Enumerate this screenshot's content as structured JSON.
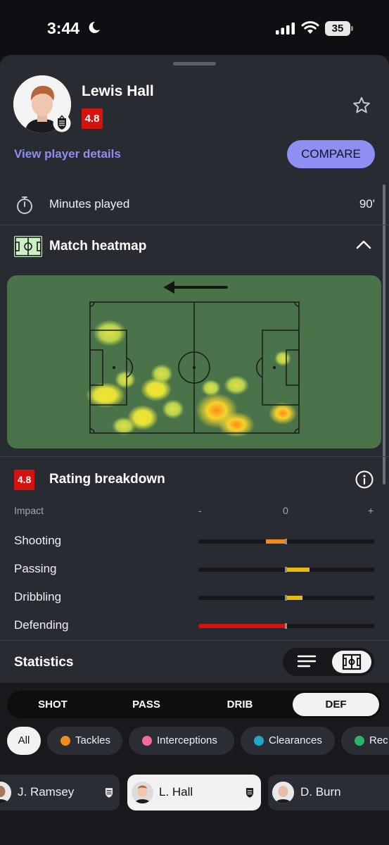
{
  "status_bar": {
    "time": "3:44",
    "battery": "35"
  },
  "player": {
    "name": "Lewis Hall",
    "rating": "4.8",
    "details_link": "View player details",
    "compare_label": "COMPARE"
  },
  "minutes": {
    "label": "Minutes played",
    "value": "90'"
  },
  "heatmap": {
    "title": "Match heatmap"
  },
  "rating_breakdown": {
    "badge": "4.8",
    "title": "Rating breakdown",
    "impact_label": "Impact",
    "scale_minus": "-",
    "scale_zero": "0",
    "scale_plus": "+",
    "rows": [
      {
        "label": "Shooting",
        "impact": -0.23,
        "color": "#f08b1d"
      },
      {
        "label": "Passing",
        "impact": 0.27,
        "color": "#e8b90e"
      },
      {
        "label": "Dribbling",
        "impact": 0.19,
        "color": "#e8b90e"
      },
      {
        "label": "Defending",
        "impact": -1.0,
        "color": "#d4130f"
      }
    ]
  },
  "statistics": {
    "title": "Statistics",
    "view_modes": [
      "list-icon",
      "pitch-icon"
    ],
    "active_view": "pitch-icon"
  },
  "category_tabs": {
    "items": [
      "SHOT",
      "PASS",
      "DRIB",
      "DEF"
    ],
    "active": "DEF"
  },
  "filters": [
    {
      "label": "All",
      "active": true
    },
    {
      "label": "Tackles",
      "color": "#f08b1d"
    },
    {
      "label": "Interceptions",
      "color": "#f46a9c"
    },
    {
      "label": "Clearances",
      "color": "#1ea7c9"
    },
    {
      "label": "Rec",
      "color": "#2ab56a"
    }
  ],
  "players": [
    {
      "name": "J. Ramsey"
    },
    {
      "name": "L. Hall",
      "active": true
    },
    {
      "name": "D. Burn"
    }
  ]
}
